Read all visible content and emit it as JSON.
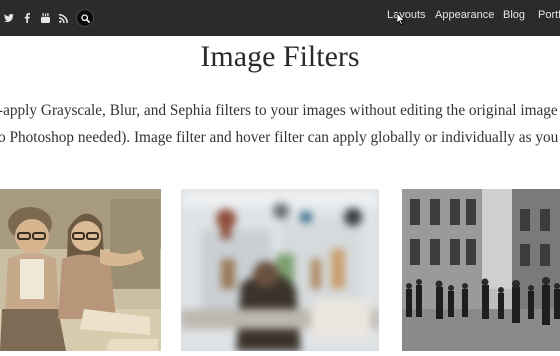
{
  "nav": {
    "items": [
      {
        "label": "Layouts"
      },
      {
        "label": "Appearance"
      },
      {
        "label": "Blog"
      },
      {
        "label": "Portf"
      }
    ]
  },
  "content": {
    "title": "Image Filters",
    "line1": "-apply Grayscale, Blur, and Sephia filters to your images without editing the original image s",
    "line2": "o Photoshop needed). Image filter and hover filter can apply globally or individually as you wa"
  },
  "icons": [
    "twitter-icon",
    "facebook-icon",
    "youtube-icon",
    "rss-icon",
    "search-icon"
  ],
  "colors": {
    "topbar": "#2b2b2b",
    "sepia": "#c6b79a",
    "gray": "#8c8c8c"
  }
}
